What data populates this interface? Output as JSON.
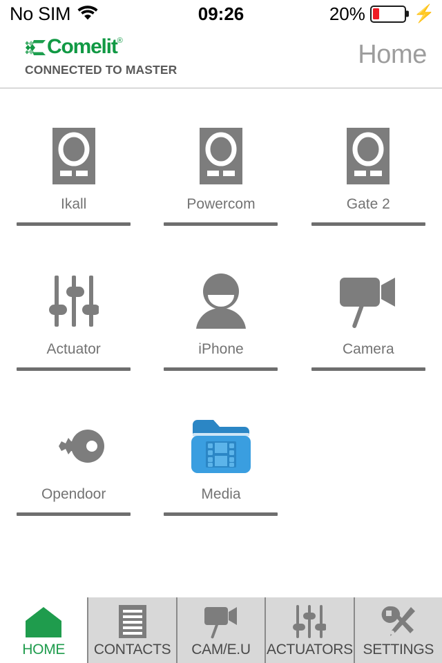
{
  "statusbar": {
    "carrier": "No SIM",
    "wifi_icon": "wifi-icon",
    "time": "09:26",
    "battery_percent": "20%",
    "battery_level": 20,
    "battery_fill_color": "#ee1c25",
    "charging_icon": "lightning-bolt-icon"
  },
  "header": {
    "brand_name": "Comelit",
    "brand_registered": "®",
    "brand_color": "#119944",
    "connection_status": "CONNECTED TO MASTER",
    "page_title": "Home",
    "page_title_color": "#9d9d9d"
  },
  "grid": {
    "icon_color": "#7d7d7d",
    "rule_color": "#6e6e6e",
    "items": [
      {
        "label": "Ikall",
        "icon": "intercom-panel-icon"
      },
      {
        "label": "Powercom",
        "icon": "intercom-panel-icon"
      },
      {
        "label": "Gate 2",
        "icon": "intercom-panel-icon"
      },
      {
        "label": "Actuator",
        "icon": "sliders-icon"
      },
      {
        "label": "iPhone",
        "icon": "person-icon"
      },
      {
        "label": "Camera",
        "icon": "video-camera-icon"
      },
      {
        "label": "Opendoor",
        "icon": "key-icon"
      },
      {
        "label": "Media",
        "icon": "media-folder-icon",
        "icon_color": "#3a9ee0"
      }
    ]
  },
  "tabbar": {
    "active_color": "#1f9c4d",
    "inactive_color": "#4a4a4a",
    "tabs": [
      {
        "label": "HOME",
        "icon": "house-icon",
        "active": true
      },
      {
        "label": "CONTACTS",
        "icon": "document-list-icon",
        "active": false
      },
      {
        "label": "CAM/E.U",
        "icon": "video-camera-icon",
        "active": false
      },
      {
        "label": "ACTUATORS",
        "icon": "sliders-icon",
        "active": false
      },
      {
        "label": "SETTINGS",
        "icon": "wrench-screwdriver-icon",
        "active": false
      }
    ]
  }
}
